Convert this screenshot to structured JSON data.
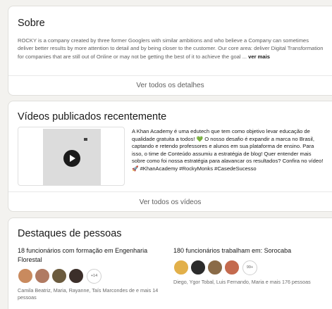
{
  "about": {
    "title": "Sobre",
    "text": "ROCKY is a company created by three former Googlers with similar ambitions and who believe a Company can sometimes deliver better results by more attention to detail and by being closer to the customer. Our core area: deliver Digital Transformation for companies that are still out of Online or may not be getting the best of it to achieve the goal ...",
    "more_label": "ver mais",
    "footer_label": "Ver todos os detalhes"
  },
  "videos": {
    "title": "Vídeos publicados recentemente",
    "description_1": "A Khan Academy é uma edutech que tem como objetivo levar educação de qualidade gratuita a todos! ",
    "heart_emoji": "💚",
    "description_2": " O nosso desafio é expandir a marca no Brasil, captando e retendo professores e alunos em sua plataforma de ensino. Para isso, o time de Conteúdo assumiu a estratégia de blog! Quer entender mais sobre como foi nossa estratégia para alavancar os resultados? Confira no vídeo! ",
    "rocket_emoji": "🚀",
    "hashtags": " #KhanAcademy #RockyMonks #CasedeSucesso",
    "footer_label": "Ver todos os vídeos"
  },
  "highlights": {
    "title": "Destaques de pessoas",
    "engineering": {
      "title": "18 funcionários com formação em Engenharia Florestal",
      "count_badge": "+14",
      "names": "Camila Beatriz, Maria, Rayanne, Taís Marcondes de e mais 14 pessoas",
      "avatar_colors": [
        "#c98a5e",
        "#b07a62",
        "#6b5b3e",
        "#3c2f2a"
      ]
    },
    "location": {
      "title": "180 funcionários trabalham em: Sorocaba",
      "count_badge": "99+",
      "names": "Diego, Ygor Tobal, Luis Fernando, Maria e mais 176 pessoas",
      "avatar_colors": [
        "#e2b04a",
        "#2b2b2b",
        "#8a6b48",
        "#c46a4e"
      ]
    }
  }
}
